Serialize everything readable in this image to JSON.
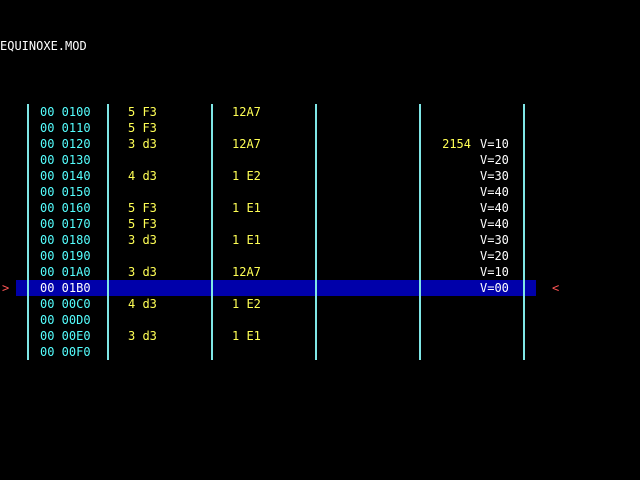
{
  "title": "EQUINOXE.MOD",
  "cursor": {
    "left_marker": ">",
    "right_marker": "<"
  },
  "colors": {
    "background": "#000000",
    "position": "#55ffff",
    "note": "#ffff55",
    "volume": "#ffffff",
    "divider": "#7fe6e6",
    "highlight": "#0000aa",
    "marker": "#ff5555"
  },
  "rows": [
    {
      "pos": "00 0100",
      "note": "5 F3",
      "effect": "12A7",
      "extra": "",
      "vol": ""
    },
    {
      "pos": "00 0110",
      "note": "5 F3",
      "effect": "",
      "extra": "",
      "vol": ""
    },
    {
      "pos": "00 0120",
      "note": "3 d3",
      "effect": "12A7",
      "extra": "2154",
      "vol": "V=10"
    },
    {
      "pos": "00 0130",
      "note": "",
      "effect": "",
      "extra": "",
      "vol": "V=20"
    },
    {
      "pos": "00 0140",
      "note": "4 d3",
      "effect": "1 E2",
      "extra": "",
      "vol": "V=30"
    },
    {
      "pos": "00 0150",
      "note": "",
      "effect": "",
      "extra": "",
      "vol": "V=40"
    },
    {
      "pos": "00 0160",
      "note": "5 F3",
      "effect": "1 E1",
      "extra": "",
      "vol": "V=40"
    },
    {
      "pos": "00 0170",
      "note": "5 F3",
      "effect": "",
      "extra": "",
      "vol": "V=40"
    },
    {
      "pos": "00 0180",
      "note": "3 d3",
      "effect": "1 E1",
      "extra": "",
      "vol": "V=30"
    },
    {
      "pos": "00 0190",
      "note": "",
      "effect": "",
      "extra": "",
      "vol": "V=20"
    },
    {
      "pos": "00 01A0",
      "note": "3 d3",
      "effect": "12A7",
      "extra": "",
      "vol": "V=10"
    },
    {
      "pos": "00 01B0",
      "note": "",
      "effect": "",
      "extra": "",
      "vol": "V=00"
    },
    {
      "pos": "00 00C0",
      "note": "4 d3",
      "effect": "1 E2",
      "extra": "",
      "vol": ""
    },
    {
      "pos": "00 00D0",
      "note": "",
      "effect": "",
      "extra": "",
      "vol": ""
    },
    {
      "pos": "00 00E0",
      "note": "3 d3",
      "effect": "1 E1",
      "extra": "",
      "vol": ""
    },
    {
      "pos": "00 00F0",
      "note": "",
      "effect": "",
      "extra": "",
      "vol": ""
    }
  ]
}
